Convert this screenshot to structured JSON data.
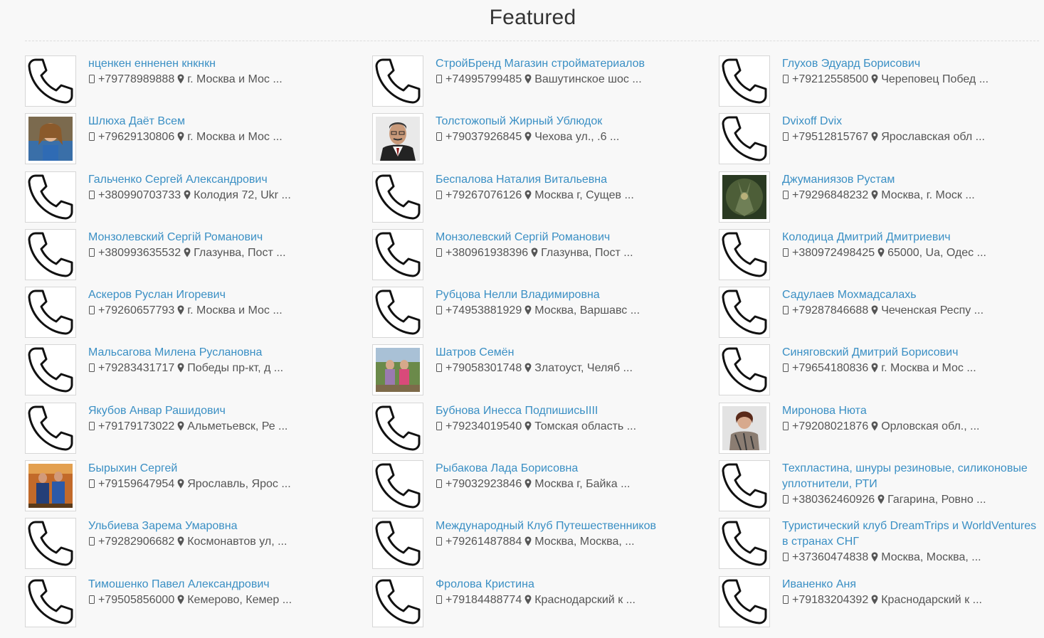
{
  "page": {
    "heading": "Featured"
  },
  "contacts": [
    {
      "name": "нценкен енненен кнкнкн",
      "phone": "+79778989888",
      "address": "г. Москва и Мос ...",
      "avatar": "phone-icon"
    },
    {
      "name": "СтройБренд Магазин стройматериалов",
      "phone": "+74995799485",
      "address": "Вашутинское шос ...",
      "avatar": "phone-icon"
    },
    {
      "name": "Глухов Эдуард Борисович",
      "phone": "+79212558500",
      "address": "Череповец Побед ...",
      "avatar": "phone-icon"
    },
    {
      "name": "Шлюха Даёт Всем",
      "phone": "+79629130806",
      "address": "г. Москва и Мос ...",
      "avatar": "photo-woman"
    },
    {
      "name": "Толстожопый Жирный Ублюдок",
      "phone": "+79037926845",
      "address": "Чехова ул., .6 ...",
      "avatar": "photo-man"
    },
    {
      "name": "Dvixoff Dvix",
      "phone": "+79512815767",
      "address": "Ярославская обл ...",
      "avatar": "phone-icon"
    },
    {
      "name": "Гальченко Сергей Александрович",
      "phone": "+380990703733",
      "address": "Колодия 72, Ukr ...",
      "avatar": "phone-icon"
    },
    {
      "name": "Беспалова Наталия Витальевна",
      "phone": "+79267076126",
      "address": "Москва г, Сущев ...",
      "avatar": "phone-icon"
    },
    {
      "name": "Джуманиязов Рустам",
      "phone": "+79296848232",
      "address": "Москва, г. Моск ...",
      "avatar": "photo-figure"
    },
    {
      "name": "Монзолевский Сергій Романович",
      "phone": "+380993635532",
      "address": "Глазунва, Пост ...",
      "avatar": "phone-icon"
    },
    {
      "name": "Монзолевский Сергій Романович",
      "phone": "+380961938396",
      "address": "Глазунва, Пост ...",
      "avatar": "phone-icon"
    },
    {
      "name": "Колодица Дмитрий Дмитриевич",
      "phone": "+380972498425",
      "address": "65000, Ua, Одес ...",
      "avatar": "phone-icon"
    },
    {
      "name": "Аскеров Руслан Игоревич",
      "phone": "+79260657793",
      "address": "г. Москва и Мос ...",
      "avatar": "phone-icon"
    },
    {
      "name": "Рубцова Нелли Владимировна",
      "phone": "+74953881929",
      "address": "Москва, Варшавс ...",
      "avatar": "phone-icon"
    },
    {
      "name": "Садулаев Мохмадсалахь",
      "phone": "+79287846688",
      "address": "Чеченская Респу ...",
      "avatar": "phone-icon"
    },
    {
      "name": "Мальсагова Милена Руслановна",
      "phone": "+79283431717",
      "address": "Победы пр-кт, д ...",
      "avatar": "phone-icon"
    },
    {
      "name": "Шатров Семён",
      "phone": "+79058301748",
      "address": "Златоуст, Челяб ...",
      "avatar": "photo-group"
    },
    {
      "name": "Синяговский Дмитрий Борисович",
      "phone": "+79654180836",
      "address": "г. Москва и Мос ...",
      "avatar": "phone-icon"
    },
    {
      "name": "Якубов Анвар Рашидович",
      "phone": "+79179173022",
      "address": "Альметьевск, Ре ...",
      "avatar": "phone-icon"
    },
    {
      "name": "Бубнова Инесса ПодпишисьIIII",
      "phone": "+79234019540",
      "address": "Томская область ...",
      "avatar": "phone-icon"
    },
    {
      "name": "Миронова Нюта",
      "phone": "+79208021876",
      "address": "Орловская обл., ...",
      "avatar": "photo-lady"
    },
    {
      "name": "Бырыхин Сергей",
      "phone": "+79159647954",
      "address": "Ярославль, Ярос ...",
      "avatar": "photo-couple"
    },
    {
      "name": "Рыбакова Лада Борисовна",
      "phone": "+79032923846",
      "address": "Москва г, Байка ...",
      "avatar": "phone-icon"
    },
    {
      "name": "Техпластина, шнуры резиновые, силиконовые уплотнители, РТИ",
      "phone": "+380362460926",
      "address": "Гагарина, Ровно ...",
      "avatar": "phone-icon"
    },
    {
      "name": "Ульбиева Зарема Умаровна",
      "phone": "+79282906682",
      "address": "Космонавтов ул, ...",
      "avatar": "phone-icon"
    },
    {
      "name": "Международный Клуб Путешественников",
      "phone": "+79261487884",
      "address": "Москва, Москва, ...",
      "avatar": "phone-icon"
    },
    {
      "name": "Туристический клуб DreamTrips и WorldVentures в странах СНГ",
      "phone": "+37360474838",
      "address": "Москва, Москва, ...",
      "avatar": "phone-icon"
    },
    {
      "name": "Тимошенко Павел Александрович",
      "phone": "+79505856000",
      "address": "Кемерово, Кемер ...",
      "avatar": "phone-icon"
    },
    {
      "name": "Фролова Кристина",
      "phone": "+79184488774",
      "address": "Краснодарский к ...",
      "avatar": "phone-icon"
    },
    {
      "name": "Иваненко Аня",
      "phone": "+79183204392",
      "address": "Краснодарский к ...",
      "avatar": "phone-icon"
    }
  ]
}
